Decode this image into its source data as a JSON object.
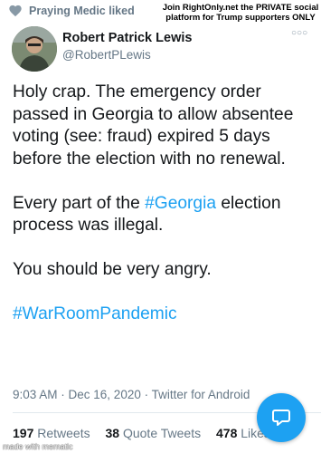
{
  "liked_bar": {
    "text": "Praying Medic liked",
    "icon": "heart-icon"
  },
  "promo_banner": {
    "line1": "Join RightOnly.net the PRIVATE social",
    "line2": "platform for Trump supporters ONLY"
  },
  "author": {
    "name": "Robert Patrick Lewis",
    "handle": "@RobertPLewis"
  },
  "tweet": {
    "paragraph1": "Holy crap. The emergency order passed in Georgia to allow absentee voting (see: fraud) expired 5 days before the election with no renewal.",
    "paragraph2_before": "Every part of the ",
    "paragraph2_hashtag": "#Georgia",
    "paragraph2_after": " election process was illegal.",
    "paragraph3": "You should be very angry.",
    "hashtag_line": "#WarRoomPandemic"
  },
  "meta": {
    "time": "9:03 AM",
    "separator": " · ",
    "date": "Dec 16, 2020",
    "source": "Twitter for Android"
  },
  "stats": {
    "retweets_count": "197",
    "retweets_label": "Retweets",
    "quotes_count": "38",
    "quotes_label": "Quote Tweets",
    "likes_count": "478",
    "likes_label": "Likes"
  },
  "compose_button": {
    "icon": "compose-tweet-icon"
  },
  "watermark": "made with mematic",
  "colors": {
    "link": "#1da1f2",
    "secondary": "#657786",
    "primary_text": "#14171a"
  }
}
